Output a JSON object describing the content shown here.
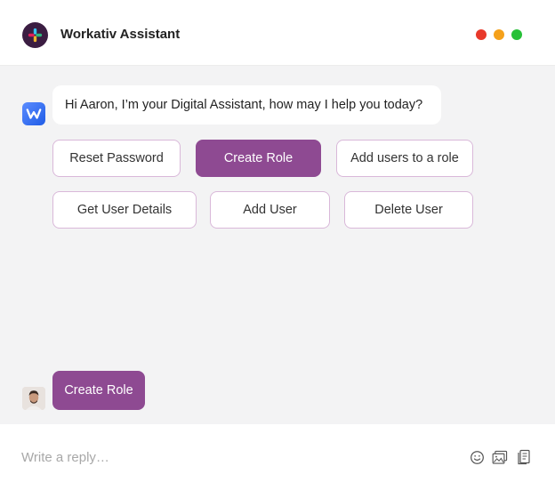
{
  "header": {
    "title": "Workativ Assistant",
    "logo_icon": "slack-logo-icon",
    "window_controls": [
      {
        "name": "close",
        "color": "#e8392b"
      },
      {
        "name": "minimize",
        "color": "#f5a11a"
      },
      {
        "name": "maximize",
        "color": "#27c038"
      }
    ]
  },
  "chat": {
    "bot_avatar_icon": "workativ-logo-icon",
    "bot_message": "Hi Aaron, I’m your Digital Assistant, how may I help you today?",
    "options": [
      {
        "label": "Reset Password",
        "selected": false
      },
      {
        "label": "Create Role",
        "selected": true
      },
      {
        "label": "Add users to a role",
        "selected": false
      },
      {
        "label": "Get User Details",
        "selected": false
      },
      {
        "label": "Add User",
        "selected": false
      },
      {
        "label": "Delete User",
        "selected": false
      }
    ],
    "user_avatar_icon": "user-avatar",
    "user_message": "Create Role"
  },
  "composer": {
    "placeholder": "Write a reply…",
    "value": "",
    "tools": [
      "emoji-icon",
      "image-icon",
      "attachment-icon"
    ]
  },
  "colors": {
    "accent": "#8e4a92",
    "chat_background": "#f3f3f4",
    "option_border": "#d9b8d9"
  }
}
